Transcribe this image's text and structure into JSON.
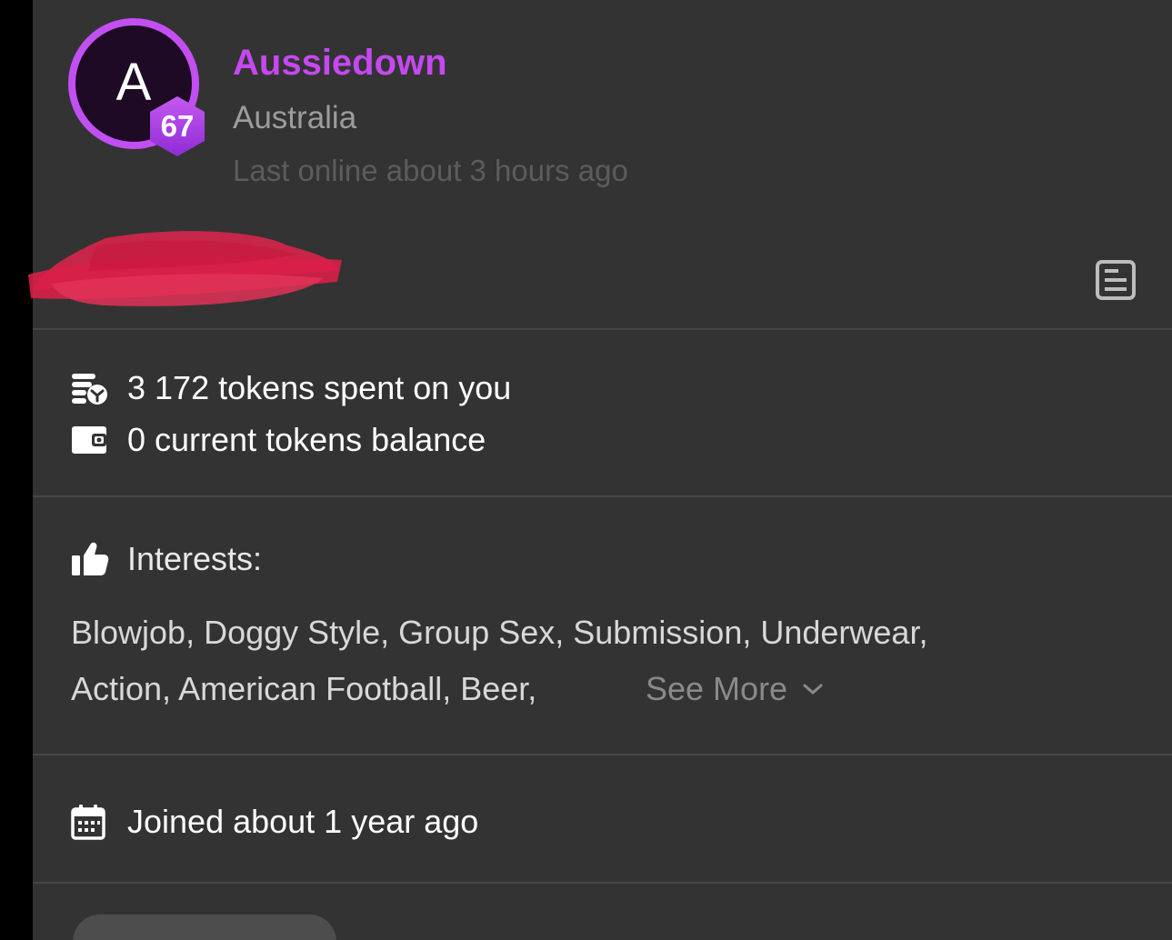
{
  "profile": {
    "avatar_letter": "A",
    "level": "67",
    "username": "Aussiedown",
    "country": "Australia",
    "last_online": "Last online about 3 hours ago"
  },
  "stats": {
    "tokens_spent": "3 172 tokens spent on you",
    "tokens_balance": "0 current tokens balance"
  },
  "interests": {
    "label": "Interests:",
    "line1": "Blowjob, Doggy Style, Group Sex, Submission, Underwear,",
    "line2": "Action, American Football, Beer,",
    "see_more": "See More"
  },
  "joined": "Joined about 1 year ago",
  "icons": {
    "tokens_spent": "coins-icon",
    "balance": "wallet-icon",
    "interests": "thumbs-up-icon",
    "joined": "calendar-icon",
    "notes": "notes-icon",
    "see_more": "chevron-down-icon"
  },
  "colors": {
    "accent": "#c24ff2",
    "username": "#c548f0",
    "panel_background": "#333333",
    "redaction": "#e0244e"
  }
}
